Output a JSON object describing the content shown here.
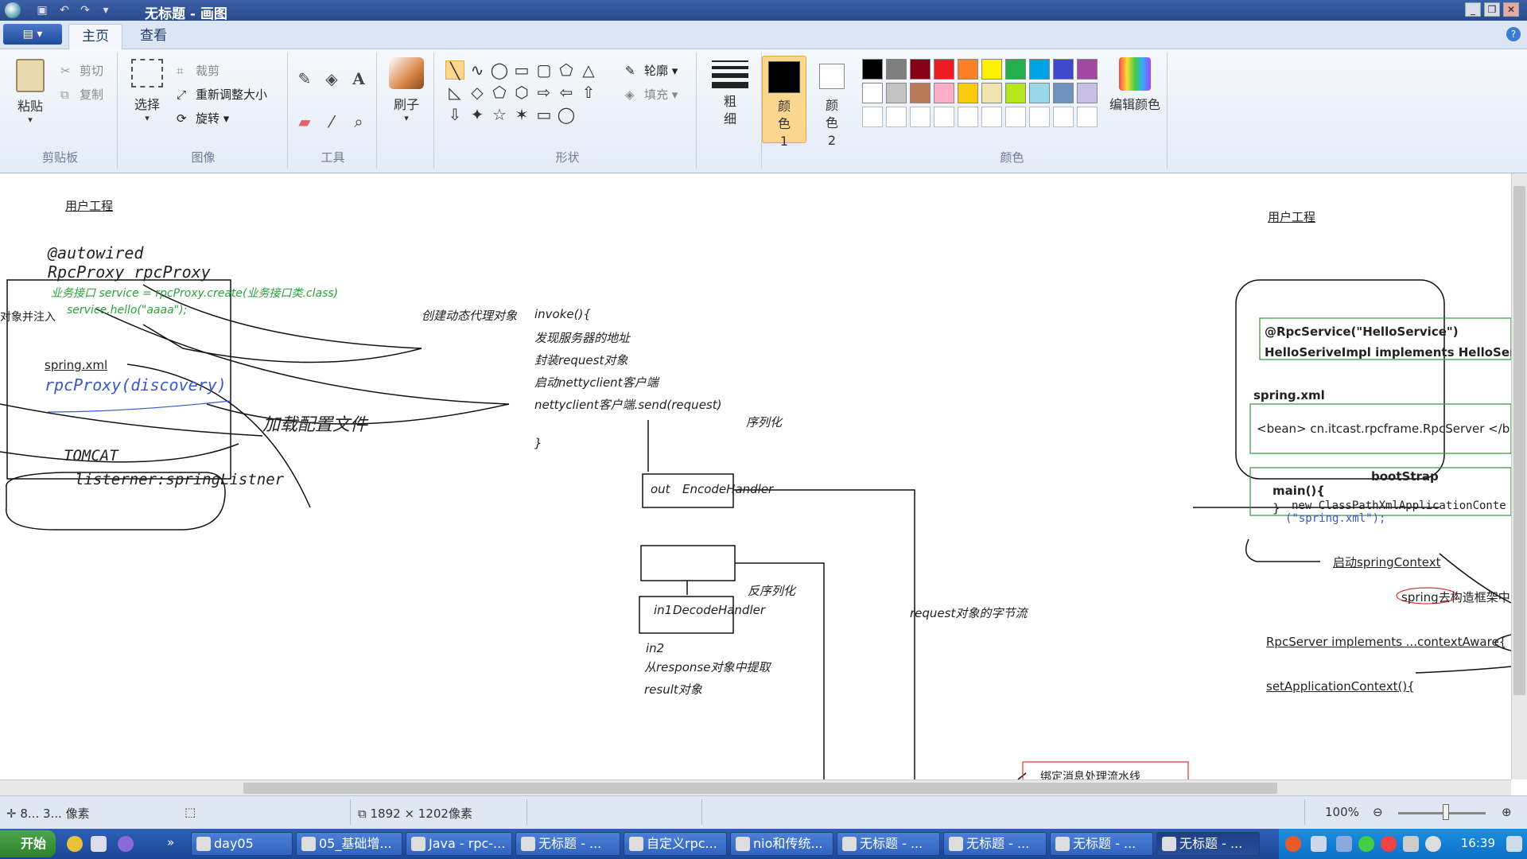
{
  "window": {
    "title": "无标题 - 画图"
  },
  "tabs": [
    "主页",
    "查看"
  ],
  "ribbon": {
    "clipboard": {
      "paste": "粘贴",
      "cut": "剪切",
      "copy": "复制",
      "label": "剪贴板"
    },
    "image": {
      "select": "选择",
      "crop": "裁剪",
      "resize": "重新调整大小",
      "rotate": "旋转",
      "label": "图像"
    },
    "tools": {
      "label": "工具"
    },
    "brush": {
      "label": "刷子"
    },
    "shapes": {
      "outline": "轮廓",
      "fill": "填充",
      "label": "形状"
    },
    "size": {
      "label": "粗细"
    },
    "color1": "颜色 1",
    "color2": "颜色 2",
    "edit_colors": "编辑颜色",
    "colors_label": "颜色",
    "palette": [
      "#000000",
      "#7f7f7f",
      "#880015",
      "#ed1c24",
      "#ff7f27",
      "#fff200",
      "#22b14c",
      "#00a2e8",
      "#3f48cc",
      "#a349a4",
      "#ffffff",
      "#c3c3c3",
      "#b97a57",
      "#ffaec9",
      "#ffc90e",
      "#efe4b0",
      "#b5e61d",
      "#99d9ea",
      "#7092be",
      "#c8bfe7"
    ]
  },
  "canvas": {
    "user_project_left": "用户工程",
    "autowired": "@autowired",
    "rpcproxy_field": "RpcProxy rpcProxy",
    "service_create": "业务接口 service = rpcProxy.create(业务接口类.class)",
    "service_hello": "service.hello(\"aaaa\");",
    "inject_label": "对象并注入",
    "spring_xml_left": "spring.xml",
    "rpcproxy_discovery": "rpcProxy(discovery)",
    "load_config": "加载配置文件",
    "tomcat": "TOMCAT",
    "listener": "listerner:springListner",
    "create_proxy": "创建动态代理对象",
    "invoke_lines": [
      "invoke(){",
      "发现服务器的地址",
      "封装request对象",
      "启动nettyclient客户端",
      "nettyclient客户端.send(request)"
    ],
    "close_brace": "}",
    "serialize": "序列化",
    "out_label": "out",
    "encode_handler": "EncodeHandler",
    "deserialize": "反序列化",
    "in1_label": "in1",
    "decode_handler": "DecodeHandler",
    "in2_label": "in2",
    "extract_result": "从response对象中提取",
    "result_obj": "result对象",
    "request_bytes": "request对象的字节流",
    "user_project_right": "用户工程",
    "rpcservice_annotation": "@RpcService(\"HelloService\")",
    "hello_impl": "HelloSeriveImpl  implements HelloServic",
    "spring_xml_right": "spring.xml",
    "bean_line": "<bean> cn.itcast.rpcframe.RpcServer </b",
    "bootstrap": "bootStrap",
    "main_line": "main(){",
    "new_ctx": "new ClassPathXmlApplicationConte",
    "spring_xml_arg": "(\"spring.xml\");",
    "close_brace_r": "}",
    "start_spring": "启动springContext",
    "spring_construct": "spring去构造框架中",
    "rpcserver_impl": "RpcServer implements ...contextAware{",
    "set_app_ctx": "setApplicationContext(){",
    "bind_msg": "绑定消息处理流水线"
  },
  "status": {
    "coords": "8... 3... 像素",
    "size": "1892 × 1202像素",
    "zoom": "100%"
  },
  "taskbar": {
    "start": "开始",
    "buttons": [
      "day05",
      "05_基础增...",
      "Java - rpc-...",
      "无标题 - ...",
      "自定义rpc...",
      "nio和传统...",
      "无标题 - ...",
      "无标题 - ...",
      "无标题 - ...",
      "无标题 - ..."
    ],
    "clock": "16:39"
  }
}
